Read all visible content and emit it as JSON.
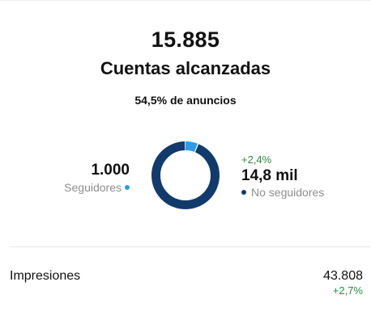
{
  "summary": {
    "accounts_reached": "15.885",
    "accounts_reached_label": "Cuentas alcanzadas",
    "ads_percentage": "54,5% de anuncios"
  },
  "audience": {
    "followers": {
      "value": "1.000",
      "label": "Seguidores",
      "color": "#2f9be6"
    },
    "non_followers": {
      "change": "+2,4%",
      "value": "14,8 mil",
      "label": "No seguidores",
      "color": "#123a6b"
    },
    "donut_shares": [
      {
        "name": "Seguidores",
        "fraction": 0.063
      },
      {
        "name": "No seguidores",
        "fraction": 0.937
      }
    ]
  },
  "impressions": {
    "label": "Impresiones",
    "value": "43.808",
    "change": "+2,7%"
  },
  "colors": {
    "positive": "#2e8b3e",
    "muted_text": "#8e8e8e"
  }
}
